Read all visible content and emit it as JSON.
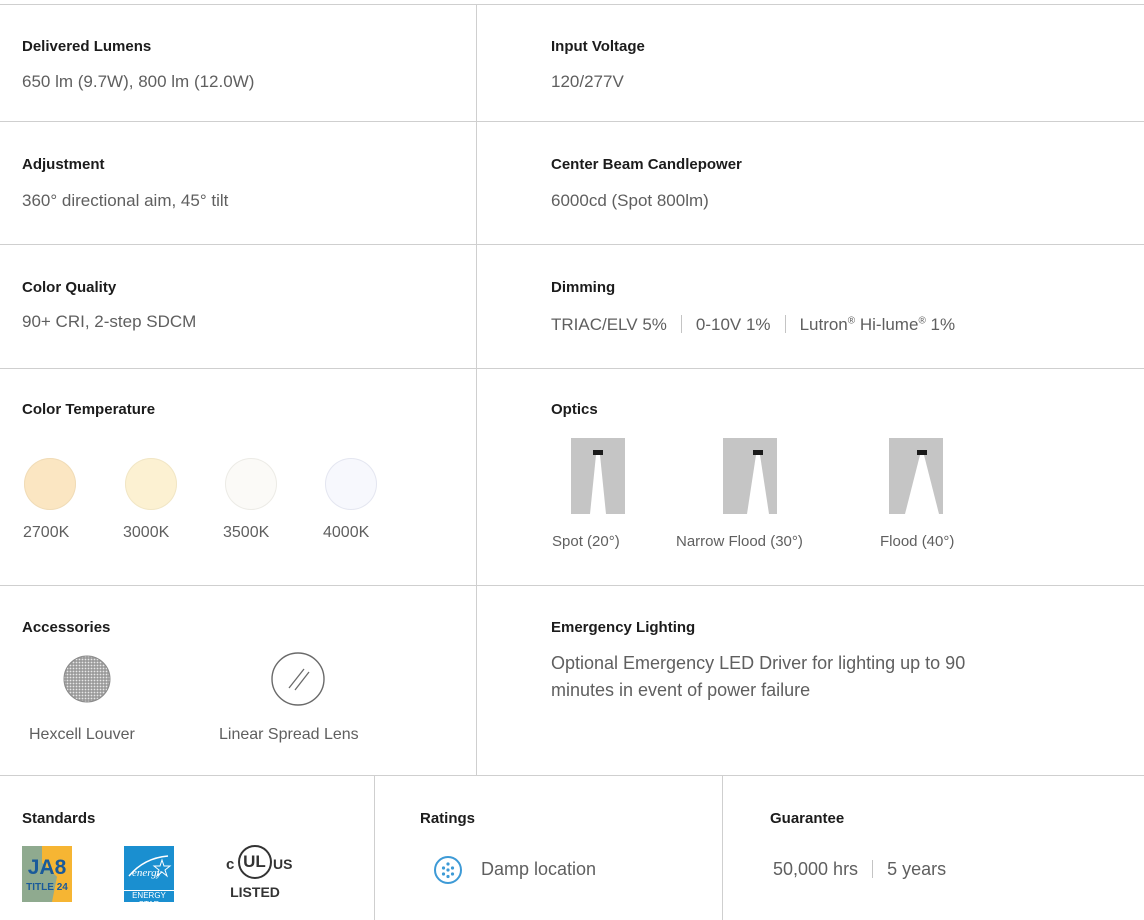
{
  "specs": {
    "delivered_lumens": {
      "label": "Delivered Lumens",
      "value": "650 lm (9.7W), 800 lm (12.0W)"
    },
    "input_voltage": {
      "label": "Input Voltage",
      "value": "120/277V"
    },
    "adjustment": {
      "label": "Adjustment",
      "value": "360° directional aim, 45° tilt"
    },
    "cbcp": {
      "label": "Center Beam Candlepower",
      "value": "6000cd (Spot 800lm)"
    },
    "color_quality": {
      "label": "Color Quality",
      "value": "90+ CRI, 2-step SDCM"
    },
    "dimming": {
      "label": "Dimming",
      "options": [
        "TRIAC/ELV 5%",
        "0-10V 1%"
      ],
      "lutron": "Lutron",
      "registered": "®",
      "hilume": " Hi-lume",
      "lutron_tail": " 1%"
    },
    "color_temperature": {
      "label": "Color Temperature",
      "swatches": [
        {
          "name": "2700K",
          "color": "#fbe6c2"
        },
        {
          "name": "3000K",
          "color": "#fcf1d2"
        },
        {
          "name": "3500K",
          "color": "#fbfaf7"
        },
        {
          "name": "4000K",
          "color": "#f7f8fd"
        }
      ]
    },
    "optics": {
      "label": "Optics",
      "items": [
        {
          "name": "Spot (20°)",
          "beam_angle": 20
        },
        {
          "name": "Narrow Flood (30°)",
          "beam_angle": 30
        },
        {
          "name": "Flood (40°)",
          "beam_angle": 40
        }
      ]
    },
    "accessories": {
      "label": "Accessories",
      "items": [
        {
          "name": "Hexcell Louver",
          "icon": "hexcell-louver-icon"
        },
        {
          "name": "Linear Spread Lens",
          "icon": "linear-spread-lens-icon"
        }
      ]
    },
    "emergency": {
      "label": "Emergency Lighting",
      "line1": "Optional Emergency LED Driver for lighting up to 90",
      "line2": "minutes in event of power failure"
    },
    "standards": {
      "label": "Standards",
      "badges": {
        "ja8_top": "JA8",
        "ja8_bottom": "TITLE 24",
        "energy_star": "ENERGY STAR",
        "ul_c": "c",
        "ul_us": "US",
        "ul_mark": "UL",
        "ul_listed": "LISTED"
      }
    },
    "ratings": {
      "label": "Ratings",
      "value": "Damp location"
    },
    "guarantee": {
      "label": "Guarantee",
      "hours": "50,000 hrs",
      "years": "5 years"
    }
  },
  "colors": {
    "divider": "#cfcfcf",
    "label": "#1c1c1c",
    "text": "#5f5f5f",
    "damp_icon": "#3d9ad6",
    "energy_star": "#1a8fd0",
    "ja8": "#f6b533"
  }
}
